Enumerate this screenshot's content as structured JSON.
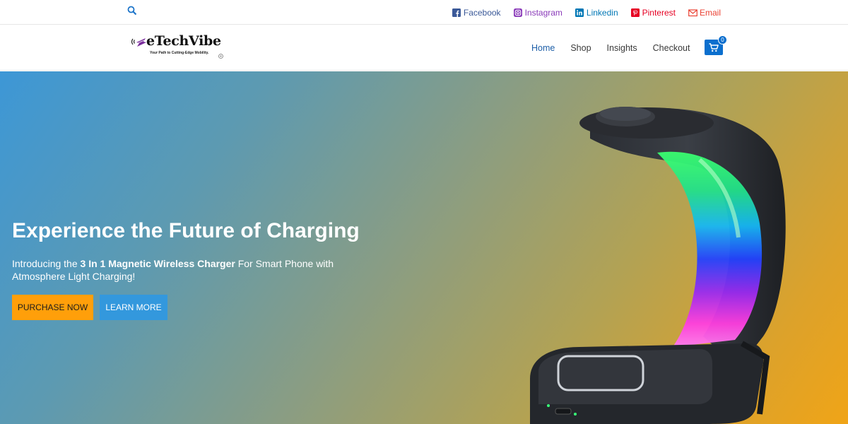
{
  "topbar": {
    "search_icon": "search-icon",
    "social": [
      {
        "label": "Facebook",
        "icon": "facebook-icon",
        "color": "#3b5998"
      },
      {
        "label": "Instagram",
        "icon": "instagram-icon",
        "color": "#8a3ab9"
      },
      {
        "label": "Linkedin",
        "icon": "linkedin-icon",
        "color": "#0077b5"
      },
      {
        "label": "Pinterest",
        "icon": "pinterest-icon",
        "color": "#e60023"
      },
      {
        "label": "Email",
        "icon": "email-icon",
        "color": "#ea4335"
      }
    ]
  },
  "header": {
    "logo": {
      "title": "eTechVibe",
      "tagline": "Your Path to Cutting-Edge Mobility."
    },
    "nav": [
      "Home",
      "Shop",
      "Insights",
      "Checkout"
    ],
    "active_nav": "Home",
    "cart_count": "0",
    "accent": "#0b6fce"
  },
  "hero": {
    "title": "Experience the Future of Charging",
    "desc_prefix": "Introducing the ",
    "desc_bold": "3 In 1 Magnetic Wireless Charger",
    "desc_suffix": " For Smart Phone with Atmosphere Light Charging!",
    "purchase_label": "PURCHASE NOW",
    "learn_label": "LEARN MORE",
    "purchase_color": "#ff9f0a",
    "learn_color": "#3398dd"
  }
}
